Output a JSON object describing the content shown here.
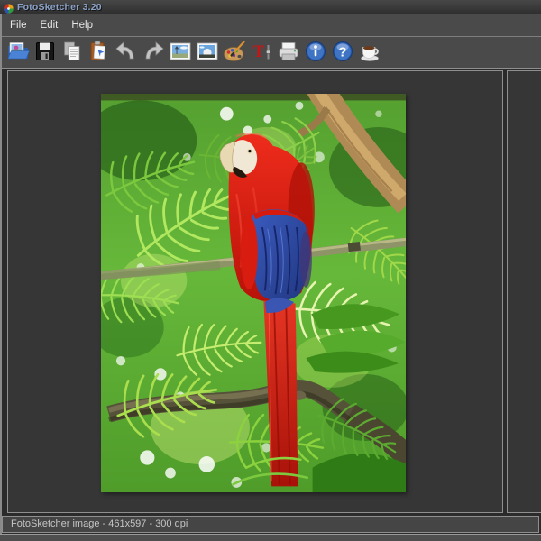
{
  "window": {
    "title": "FotoSketcher 3.20",
    "app_icon": "color-wheel-icon"
  },
  "menu_bar": {
    "items": [
      {
        "id": "file",
        "label": "File"
      },
      {
        "id": "edit",
        "label": "Edit"
      },
      {
        "id": "help",
        "label": "Help"
      }
    ]
  },
  "toolbar": {
    "buttons": [
      {
        "name": "open-image",
        "icon": "folder-open-icon"
      },
      {
        "name": "save-image",
        "icon": "floppy-disk-icon"
      },
      {
        "name": "copy",
        "icon": "copy-documents-icon"
      },
      {
        "name": "paste",
        "icon": "clipboard-paste-icon"
      },
      {
        "name": "undo",
        "icon": "undo-arrow-icon"
      },
      {
        "name": "redo",
        "icon": "redo-arrow-icon"
      },
      {
        "name": "view-original-image",
        "icon": "photo-landscape-icon"
      },
      {
        "name": "view-drawing",
        "icon": "photo-dome-icon"
      },
      {
        "name": "drawing-parameters",
        "icon": "paint-palette-icon"
      },
      {
        "name": "add-text",
        "icon": "text-tool-icon",
        "glyph": "T"
      },
      {
        "name": "print",
        "icon": "printer-icon"
      },
      {
        "name": "about",
        "icon": "info-circle-icon"
      },
      {
        "name": "help",
        "icon": "question-circle-icon",
        "glyph": "?"
      },
      {
        "name": "donate-coffee",
        "icon": "coffee-cup-icon"
      }
    ]
  },
  "main": {
    "source_image": {
      "description": "Scarlet macaw parrot with long red tail and blue wing, perched on a branch among bright green jungle palm fronds"
    }
  },
  "status_bar": {
    "text": "FotoSketcher image - 461x597 - 300 dpi"
  },
  "colors": {
    "chrome_bg": "#4a4a4a",
    "titlebar_bg": "#383838",
    "workspace_bg": "#2b2b2b",
    "panel_bg": "#363636",
    "panel_border": "#8f8f8f",
    "title_text": "#8ba2c8",
    "status_text": "#c6c6c6",
    "parrot_red": "#d8261a",
    "parrot_wing_blue": "#3558b8",
    "jungle_green": "#5fae33"
  }
}
